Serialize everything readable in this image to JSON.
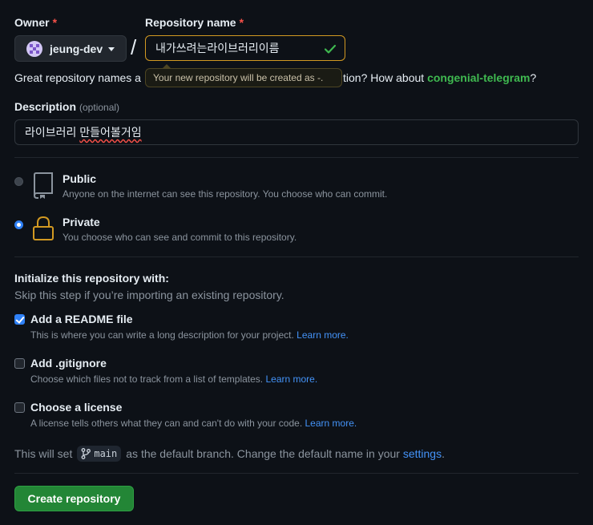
{
  "owner": {
    "label": "Owner",
    "required_mark": "*",
    "value": "jeung-dev"
  },
  "repo_name": {
    "label": "Repository name",
    "required_mark": "*",
    "value": "내가쓰려는라이브러리이름",
    "slash": "/"
  },
  "tooltip": {
    "text": "Your new repository will be created as -."
  },
  "name_hint": {
    "prefix": "Great repository names a",
    "suffix": "tion? How about",
    "suggestion": "congenial-telegram",
    "end": "?"
  },
  "description": {
    "label": "Description",
    "optional": "(optional)",
    "value_plain": "라이브러리 ",
    "value_underlined": "만들어볼거임"
  },
  "visibility": {
    "public": {
      "title": "Public",
      "subtitle": "Anyone on the internet can see this repository. You choose who can commit.",
      "selected": false
    },
    "private": {
      "title": "Private",
      "subtitle": "You choose who can see and commit to this repository.",
      "selected": true
    }
  },
  "init": {
    "title": "Initialize this repository with:",
    "subtitle": "Skip this step if you’re importing an existing repository.",
    "readme": {
      "title": "Add a README file",
      "subtitle": "This is where you can write a long description for your project.",
      "link": "Learn more.",
      "checked": true
    },
    "gitignore": {
      "title": "Add .gitignore",
      "subtitle": "Choose which files not to track from a list of templates.",
      "link": "Learn more.",
      "checked": false
    },
    "license": {
      "title": "Choose a license",
      "subtitle": "A license tells others what they can and can't do with your code.",
      "link": "Learn more.",
      "checked": false
    }
  },
  "branch": {
    "prefix": "This will set",
    "name": "main",
    "middle": "as the default branch. Change the default name in your",
    "link": "settings",
    "end": "."
  },
  "create_button": {
    "label": "Create repository"
  },
  "colors": {
    "background": "#0d1117",
    "accent_blue": "#2f81f7",
    "success_green": "#238636",
    "suggestion_green": "#3fb950",
    "warning_border": "#d29922"
  }
}
